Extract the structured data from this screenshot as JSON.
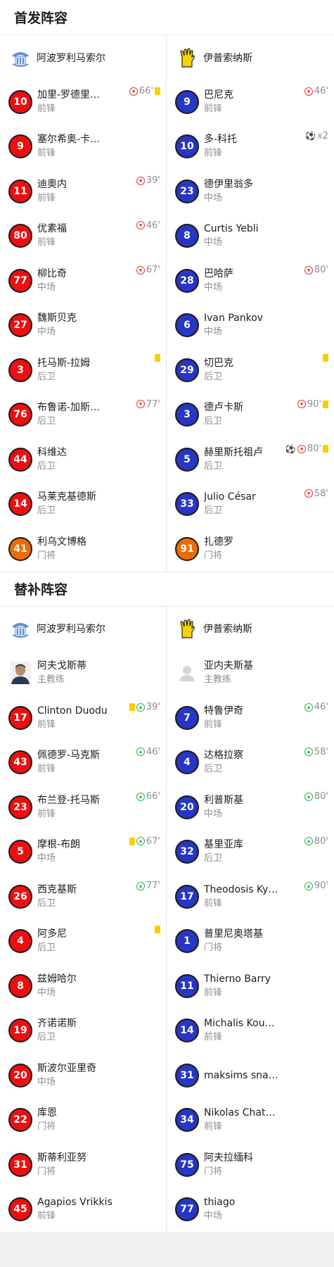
{
  "starting": {
    "title": "首发阵容",
    "home_team": "阿波罗利马索尔",
    "away_team": "伊普索纳斯",
    "home": [
      {
        "num": "10",
        "name": "加里-罗德里…",
        "pos": "前锋",
        "events": [
          {
            "type": "sub-out",
            "text": "66'"
          },
          {
            "type": "card"
          }
        ]
      },
      {
        "num": "9",
        "name": "塞尔希奥-卡…",
        "pos": "前锋",
        "events": []
      },
      {
        "num": "11",
        "name": "迪奥内",
        "pos": "前锋",
        "events": [
          {
            "type": "sub-out",
            "text": "39'"
          }
        ]
      },
      {
        "num": "80",
        "name": "优素福",
        "pos": "前锋",
        "events": [
          {
            "type": "sub-out",
            "text": "46'"
          }
        ]
      },
      {
        "num": "77",
        "name": "柳比奇",
        "pos": "中场",
        "events": [
          {
            "type": "sub-out",
            "text": "67'"
          }
        ]
      },
      {
        "num": "27",
        "name": "魏斯贝克",
        "pos": "中场",
        "events": []
      },
      {
        "num": "3",
        "name": "托马斯-拉姆",
        "pos": "后卫",
        "events": [
          {
            "type": "card"
          }
        ]
      },
      {
        "num": "76",
        "name": "布鲁诺-加斯…",
        "pos": "后卫",
        "events": [
          {
            "type": "sub-out",
            "text": "77'"
          }
        ]
      },
      {
        "num": "44",
        "name": "科维达",
        "pos": "后卫",
        "events": []
      },
      {
        "num": "14",
        "name": "马莱克基德斯",
        "pos": "后卫",
        "events": []
      },
      {
        "num": "41",
        "name": "利乌文博格",
        "pos": "门将",
        "events": [],
        "gk": true
      }
    ],
    "away": [
      {
        "num": "9",
        "name": "巴尼克",
        "pos": "前锋",
        "events": [
          {
            "type": "sub-out",
            "text": "46'"
          }
        ]
      },
      {
        "num": "10",
        "name": "多-科托",
        "pos": "前锋",
        "events": [
          {
            "type": "goal"
          },
          {
            "type": "text",
            "text": "x2"
          }
        ]
      },
      {
        "num": "23",
        "name": "德伊里翁多",
        "pos": "中场",
        "events": []
      },
      {
        "num": "8",
        "name": "Curtis Yebli",
        "pos": "中场",
        "events": []
      },
      {
        "num": "28",
        "name": "巴哈萨",
        "pos": "中场",
        "events": [
          {
            "type": "sub-out",
            "text": "80'"
          }
        ]
      },
      {
        "num": "6",
        "name": "Ivan Pankov",
        "pos": "中场",
        "events": []
      },
      {
        "num": "29",
        "name": "切巴克",
        "pos": "后卫",
        "events": [
          {
            "type": "card"
          }
        ]
      },
      {
        "num": "3",
        "name": "德卢卡斯",
        "pos": "后卫",
        "events": [
          {
            "type": "sub-out",
            "text": "90'"
          },
          {
            "type": "card"
          }
        ]
      },
      {
        "num": "5",
        "name": "赫里斯托祖卢",
        "pos": "后卫",
        "events": [
          {
            "type": "goal"
          },
          {
            "type": "sub-out",
            "text": "80'"
          },
          {
            "type": "card"
          }
        ]
      },
      {
        "num": "33",
        "name": "Julio César",
        "pos": "后卫",
        "events": [
          {
            "type": "sub-out",
            "text": "58'"
          }
        ]
      },
      {
        "num": "91",
        "name": "扎德罗",
        "pos": "门将",
        "events": [],
        "gk": true
      }
    ]
  },
  "subs": {
    "title": "替补阵容",
    "home_team": "阿波罗利马索尔",
    "away_team": "伊普索纳斯",
    "home_coach": {
      "name": "阿夫戈斯蒂",
      "role": "主教练"
    },
    "away_coach": {
      "name": "亚内夫斯基",
      "role": "主教练"
    },
    "home": [
      {
        "num": "17",
        "name": "Clinton Duodu",
        "pos": "前锋",
        "events": [
          {
            "type": "card"
          },
          {
            "type": "sub-in",
            "text": "39'"
          }
        ]
      },
      {
        "num": "43",
        "name": "佩德罗-马克斯",
        "pos": "前锋",
        "events": [
          {
            "type": "sub-in",
            "text": "46'"
          }
        ]
      },
      {
        "num": "23",
        "name": "布兰登-托马斯",
        "pos": "前锋",
        "events": [
          {
            "type": "sub-in",
            "text": "66'"
          }
        ]
      },
      {
        "num": "5",
        "name": "摩根-布朗",
        "pos": "中场",
        "events": [
          {
            "type": "card"
          },
          {
            "type": "sub-in",
            "text": "67'"
          }
        ]
      },
      {
        "num": "26",
        "name": "西克基斯",
        "pos": "后卫",
        "events": [
          {
            "type": "sub-in",
            "text": "77'"
          }
        ]
      },
      {
        "num": "4",
        "name": "阿多尼",
        "pos": "后卫",
        "events": [
          {
            "type": "card"
          }
        ]
      },
      {
        "num": "8",
        "name": "兹姆哈尔",
        "pos": "中场",
        "events": []
      },
      {
        "num": "19",
        "name": "齐诺诺斯",
        "pos": "后卫",
        "events": []
      },
      {
        "num": "20",
        "name": "斯波尔亚里奇",
        "pos": "中场",
        "events": []
      },
      {
        "num": "22",
        "name": "库恩",
        "pos": "门将",
        "events": []
      },
      {
        "num": "31",
        "name": "斯蒂利亚努",
        "pos": "门将",
        "events": []
      },
      {
        "num": "45",
        "name": "Agapios Vrikkis",
        "pos": "前锋",
        "events": []
      }
    ],
    "away": [
      {
        "num": "7",
        "name": "特鲁伊奇",
        "pos": "前锋",
        "events": [
          {
            "type": "sub-in",
            "text": "46'"
          }
        ]
      },
      {
        "num": "4",
        "name": "达格拉察",
        "pos": "后卫",
        "events": [
          {
            "type": "sub-in",
            "text": "58'"
          }
        ]
      },
      {
        "num": "20",
        "name": "利普斯基",
        "pos": "中场",
        "events": [
          {
            "type": "sub-in",
            "text": "80'"
          }
        ]
      },
      {
        "num": "32",
        "name": "基里亚库",
        "pos": "后卫",
        "events": [
          {
            "type": "sub-in",
            "text": "80'"
          }
        ]
      },
      {
        "num": "17",
        "name": "Theodosis Ky…",
        "pos": "前锋",
        "events": [
          {
            "type": "sub-in",
            "text": "90'"
          }
        ]
      },
      {
        "num": "1",
        "name": "普里尼奥塔基",
        "pos": "门将",
        "events": []
      },
      {
        "num": "11",
        "name": "Thierno Barry",
        "pos": "前锋",
        "events": []
      },
      {
        "num": "14",
        "name": "Michalis Kou…",
        "pos": "前锋",
        "events": []
      },
      {
        "num": "31",
        "name": "maksims sna…",
        "pos": "",
        "events": []
      },
      {
        "num": "34",
        "name": "Nikolas Chat…",
        "pos": "前锋",
        "events": []
      },
      {
        "num": "75",
        "name": "阿夫拉缅科",
        "pos": "门将",
        "events": []
      },
      {
        "num": "77",
        "name": "thiago",
        "pos": "中场",
        "events": []
      }
    ]
  },
  "colors": {
    "home": "#ee0d10",
    "away": "#2736c4",
    "goalkeeper": "#f06a00",
    "card": "#f7d000",
    "sub_in": "#2eb34a",
    "sub_out": "#e23a2e"
  },
  "icons": {
    "home_crest": "apollon-crest-icon",
    "away_crest": "ypsonas-glove-crest-icon",
    "coach_photo": "coach-avatar-icon",
    "coach_placeholder": "person-placeholder-icon"
  }
}
